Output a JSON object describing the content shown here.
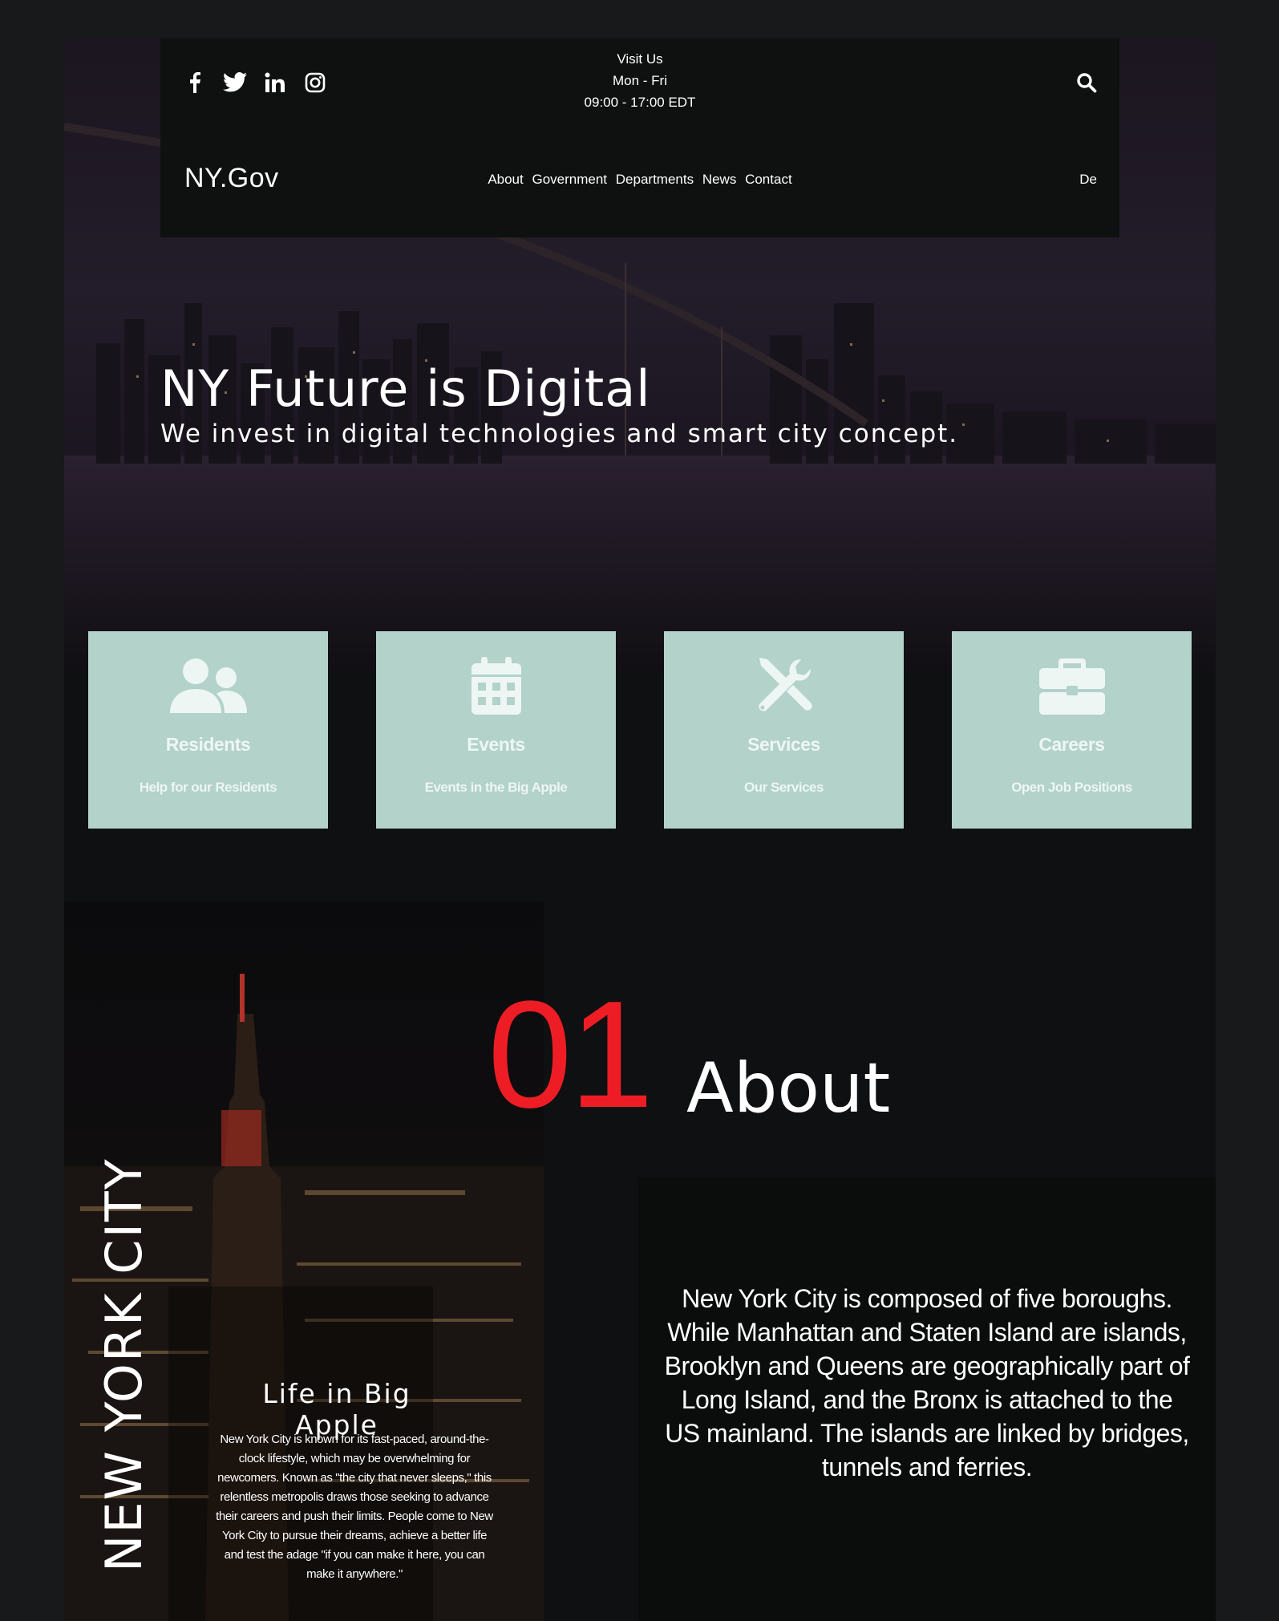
{
  "header": {
    "social": [
      "facebook-icon",
      "twitter-icon",
      "linkedin-icon",
      "instagram-icon"
    ],
    "visit_title": "Visit Us",
    "visit_days": "Mon - Fri",
    "visit_hours": "09:00 - 17:00 EDT",
    "logo": "NY.Gov",
    "nav": [
      "About",
      "Government",
      "Departments",
      "News",
      "Contact"
    ],
    "lang": "De",
    "search_icon": "search-icon"
  },
  "hero": {
    "title": "NY Future is Digital",
    "subtitle": "We invest in digital technologies and smart city concept."
  },
  "cards": [
    {
      "icon": "users-icon",
      "title": "Residents",
      "subtitle": "Help for our Residents"
    },
    {
      "icon": "calendar-icon",
      "title": "Events",
      "subtitle": "Events in the Big Apple"
    },
    {
      "icon": "tools-icon",
      "title": "Services",
      "subtitle": "Our Services"
    },
    {
      "icon": "briefcase-icon",
      "title": "Careers",
      "subtitle": "Open Job Positions"
    }
  ],
  "nyc": {
    "vertical_label": "NEW YORK CITY",
    "life_title": "Life in Big Apple",
    "life_text": "New York City is known for its fast-paced, around-the-clock lifestyle, which may be overwhelming for newcomers. Known as \"the city that never sleeps,\" this relentless metropolis draws those seeking to advance their careers and push their limits. People come to New York City to pursue their dreams, achieve a better life and test the adage \"if you can make it here, you can make it anywhere.\""
  },
  "about": {
    "number": "01",
    "heading": "About",
    "text": "New York City is composed of five boroughs. While Manhattan and Staten Island are islands, Brooklyn and Queens are geographically part of Long Island, and the Bronx is attached to the US mainland. The islands are linked by bridges, tunnels and ferries."
  },
  "colors": {
    "accent_red": "#ee1d25",
    "card_bg": "#b2d2ca",
    "page_bg": "#0e1011"
  }
}
